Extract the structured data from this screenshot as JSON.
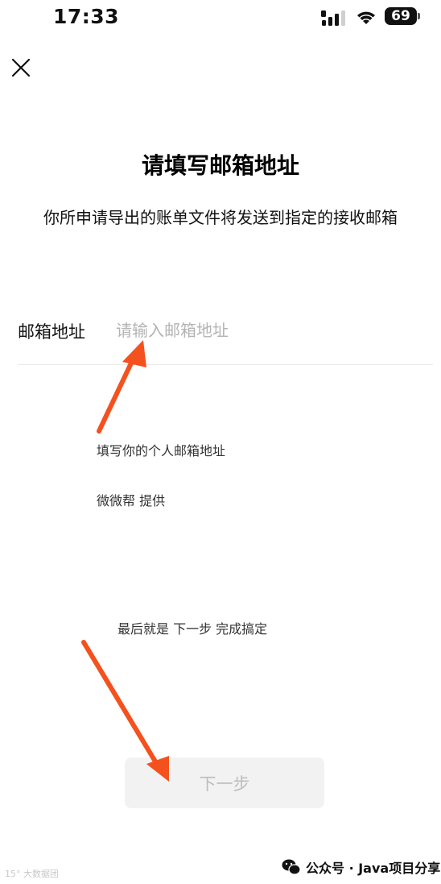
{
  "status_bar": {
    "time": "17:33",
    "battery": "69"
  },
  "page": {
    "title": "请填写邮箱地址",
    "subtitle": "你所申请导出的账单文件将发送到指定的接收邮箱"
  },
  "form": {
    "label": "邮箱地址",
    "email_value": "",
    "email_placeholder": "请输入邮箱地址"
  },
  "notes": {
    "fill_hint": "填写你的个人邮箱地址",
    "provider": "微微帮 提供",
    "final_step": "最后就是 下一步  完成搞定"
  },
  "actions": {
    "next_label": "下一步"
  },
  "annotations": {
    "arrow_color": "#f4511e"
  },
  "footer": {
    "watermark": "15° 大数据团",
    "brand": "公众号 · Java项目分享"
  },
  "colors": {
    "placeholder": "#b3b3b3",
    "button_bg": "#f2f2f2",
    "button_text": "#bdbdbd",
    "divider": "#e9e9e9"
  }
}
